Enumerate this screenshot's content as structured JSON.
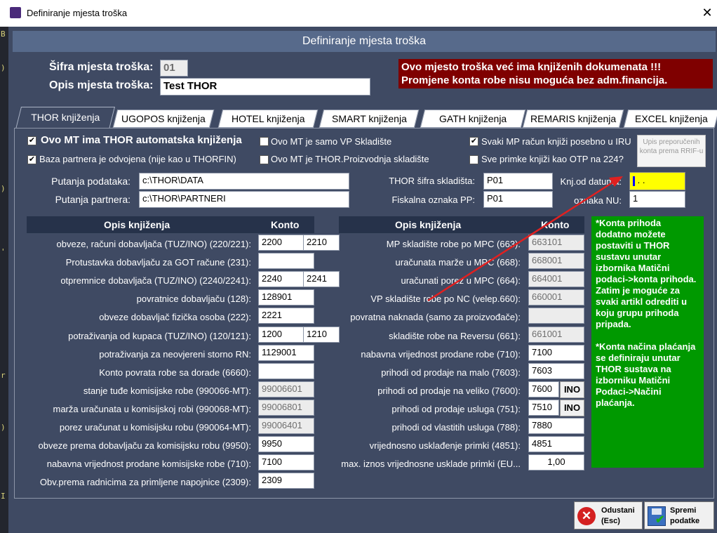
{
  "window": {
    "title": "Definiranje mjesta troška"
  },
  "header": {
    "title": "Definiranje mjesta troška"
  },
  "sifra": {
    "label": "Šifra mjesta troška:",
    "value": "01"
  },
  "opis": {
    "label": "Opis mjesta troška:",
    "value": "Test THOR"
  },
  "warning": {
    "line1": "Ovo mjesto troška već ima knjiženih dokumenata !!!",
    "line2": "Promjene konta robe nisu moguća bez adm.financija."
  },
  "tabs": [
    {
      "label": "THOR knjiženja"
    },
    {
      "label": "UGOPOS knjiženja"
    },
    {
      "label": "HOTEL knjiženja"
    },
    {
      "label": "SMART knjiženja"
    },
    {
      "label": "GATH knjiženja"
    },
    {
      "label": "REMARIS knjiženja"
    },
    {
      "label": "EXCEL knjiženja"
    }
  ],
  "checks": {
    "auto": {
      "label": "Ovo MT ima THOR automatska knjiženja",
      "checked": true
    },
    "baza": {
      "label": "Baza partnera je odvojena (nije kao u THORFIN)",
      "checked": true
    },
    "vp": {
      "label": "Ovo MT je samo VP Skladište",
      "checked": false
    },
    "proiz": {
      "label": "Ovo MT je THOR.Proizvodnja skladište",
      "checked": false
    },
    "iru": {
      "label": "Svaki MP račun knjiži posebno u IRU",
      "checked": true
    },
    "otp": {
      "label": "Sve primke knjiži kao OTP na 224?",
      "checked": false
    }
  },
  "upis_button": "Upis preporučenih konta prema RRIF-u",
  "paths": {
    "podataka_label": "Putanja podataka:",
    "podataka_value": "c:\\THOR\\DATA",
    "partnera_label": "Putanja partnera:",
    "partnera_value": "c:\\THOR\\PARTNERI"
  },
  "skladiste": {
    "sifra_label": "THOR šifra skladišta:",
    "sifra_value": "P01",
    "fisk_label": "Fiskalna oznaka PP:",
    "fisk_value": "P01"
  },
  "knj": {
    "datum_label": "Knj.od datuma:",
    "datum_value": " .  .",
    "nu_label": "oznaka NU:",
    "nu_value": "1"
  },
  "left_table": {
    "col1": "Opis knjiženja",
    "col2": "Konto",
    "rows": [
      {
        "label": "obveze, računi dobavljača (TUZ/INO) (220/221):",
        "v1": "2200",
        "v2": "2210"
      },
      {
        "label": "Protustavka dobavljaču za GOT račune (231):",
        "v1": "",
        "v2": null
      },
      {
        "label": "otpremnice dobavljača (TUZ/INO) (2240/2241):",
        "v1": "2240",
        "v2": "2241"
      },
      {
        "label": "povratnice dobavljaču (128):",
        "v1": "128901",
        "v2": null
      },
      {
        "label": "obveze dobavljač fizička osoba (222):",
        "v1": "2221",
        "v2": null
      },
      {
        "label": "potraživanja od kupaca (TUZ/INO) (120/121):",
        "v1": "1200",
        "v2": "1210"
      },
      {
        "label": "potraživanja za neovjereni storno RN:",
        "v1": "1129001",
        "v2": null
      },
      {
        "label": "Konto povrata robe sa dorade (6660):",
        "v1": "",
        "v2": null
      },
      {
        "label": "stanje tuđe komisijske robe (990066-MT):",
        "v1": "99006601",
        "v2": null,
        "gray": true
      },
      {
        "label": "marža uračunata u komisijskoj robi (990068-MT):",
        "v1": "99006801",
        "v2": null,
        "gray": true
      },
      {
        "label": "porez uračunat u komisijsku robu (990064-MT):",
        "v1": "99006401",
        "v2": null,
        "gray": true
      },
      {
        "label": "obveze prema dobavljaču za komisijsku robu (9950):",
        "v1": "9950",
        "v2": null
      },
      {
        "label": "nabavna vrijednost prodane komisijske robe (710):",
        "v1": "7100",
        "v2": null
      },
      {
        "label": "Obv.prema radnicima za primljene napojnice (2309):",
        "v1": "2309",
        "v2": null
      }
    ]
  },
  "right_table": {
    "col1": "Opis knjiženja",
    "col2": "Konto",
    "rows": [
      {
        "label": "MP skladište robe po MPC (663):",
        "v1": "663101",
        "gray": true
      },
      {
        "label": "uračunata marže u MPC (668):",
        "v1": "668001",
        "gray": true
      },
      {
        "label": "uračunati porez u MPC (664):",
        "v1": "664001",
        "gray": true
      },
      {
        "label": "VP skladište robe po NC (velep.660):",
        "v1": "660001",
        "gray": true
      },
      {
        "label": "povratna naknada (samo za proizvođače):",
        "v1": "",
        "gray": true
      },
      {
        "label": "skladište robe na Reversu (661):",
        "v1": "661001",
        "gray": true
      },
      {
        "label": "nabavna vrijednost prodane robe (710):",
        "v1": "7100"
      },
      {
        "label": "prihodi od prodaje na malo (7603):",
        "v1": "7603"
      },
      {
        "label": "prihodi od prodaje na veliko (7600):",
        "v1": "7600",
        "btn": "INO"
      },
      {
        "label": "prihodi od prodaje usluga (751):",
        "v1": "7510",
        "btn": "INO"
      },
      {
        "label": "prihodi od vlastitih usluga (788):",
        "v1": "7880"
      },
      {
        "label": "vrijednosno usklađenje primki (4851):",
        "v1": "4851"
      },
      {
        "label": "max. iznos vrijednosne usklade primki (EU...",
        "v1": "1,00",
        "right": true
      }
    ]
  },
  "info": "*Konta prihoda dodatno možete postaviti u THOR sustavu unutar izbornika Matični podaci->konta prihoda. Zatim je moguće za svaki artikl odrediti u koju grupu prihoda pripada.\n\n*Konta načina plaćanja se definiraju unutar THOR sustava na izborniku Matični Podaci->Načini plaćanja.",
  "buttons": {
    "cancel_line1": "Odustani",
    "cancel_line2": "(Esc)",
    "save_line1": "Spremi",
    "save_line2": "podatke"
  },
  "colors": {
    "panel": "#3f4a63",
    "header": "#576a8b",
    "warning": "#7f0000",
    "info": "#009900",
    "date_highlight": "#ffff00",
    "arrow": "#e02020"
  }
}
